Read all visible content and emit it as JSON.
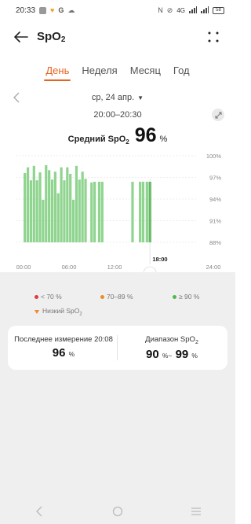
{
  "status_bar": {
    "time": "20:33",
    "network": "4G",
    "battery": "58"
  },
  "app_bar": {
    "title_main": "SpO",
    "title_sub": "2"
  },
  "tabs": [
    {
      "label": "День",
      "active": true
    },
    {
      "label": "Неделя",
      "active": false
    },
    {
      "label": "Месяц",
      "active": false
    },
    {
      "label": "Год",
      "active": false
    }
  ],
  "date": {
    "label": "ср, 24 апр.",
    "time_range": "20:00–20:30"
  },
  "average": {
    "label_main": "Средний SpO",
    "label_sub": "2",
    "value": "96",
    "unit": "%"
  },
  "chart_data": {
    "type": "bar",
    "y_ticks": [
      "100%",
      "97%",
      "94%",
      "91%",
      "88%"
    ],
    "x_ticks": [
      "00:00",
      "06:00",
      "12:00",
      "18:00",
      "24:00"
    ],
    "selected_time": "18:00",
    "ylim": [
      88,
      100
    ],
    "unit": "%",
    "bar_color": "#8fd48f",
    "highlight_color": "#43b343",
    "bars": [
      {
        "x": 1.2,
        "high": 97.6,
        "low": 88
      },
      {
        "x": 1.6,
        "high": 98.4,
        "low": 88
      },
      {
        "x": 2.0,
        "high": 96.6,
        "low": 88
      },
      {
        "x": 2.4,
        "high": 98.6,
        "low": 88
      },
      {
        "x": 2.8,
        "high": 96.6,
        "low": 88
      },
      {
        "x": 3.2,
        "high": 97.7,
        "low": 88
      },
      {
        "x": 3.6,
        "high": 93.9,
        "low": 88
      },
      {
        "x": 4.0,
        "high": 98.7,
        "low": 88
      },
      {
        "x": 4.4,
        "high": 98.0,
        "low": 88
      },
      {
        "x": 4.8,
        "high": 96.7,
        "low": 88
      },
      {
        "x": 5.2,
        "high": 97.8,
        "low": 88
      },
      {
        "x": 5.6,
        "high": 94.8,
        "low": 88
      },
      {
        "x": 6.0,
        "high": 98.4,
        "low": 88
      },
      {
        "x": 6.4,
        "high": 96.6,
        "low": 88
      },
      {
        "x": 6.8,
        "high": 98.4,
        "low": 88
      },
      {
        "x": 7.2,
        "high": 97.5,
        "low": 88
      },
      {
        "x": 7.6,
        "high": 93.9,
        "low": 88
      },
      {
        "x": 8.0,
        "high": 98.6,
        "low": 88
      },
      {
        "x": 8.4,
        "high": 96.7,
        "low": 88
      },
      {
        "x": 8.8,
        "high": 97.8,
        "low": 88
      },
      {
        "x": 9.2,
        "high": 96.8,
        "low": 88
      },
      {
        "x": 10.0,
        "high": 96.3,
        "low": 88
      },
      {
        "x": 10.4,
        "high": 96.4,
        "low": 88
      },
      {
        "x": 11.0,
        "high": 96.4,
        "low": 88
      },
      {
        "x": 11.4,
        "high": 96.4,
        "low": 88
      },
      {
        "x": 15.4,
        "high": 96.4,
        "low": 88
      },
      {
        "x": 16.4,
        "high": 96.4,
        "low": 88
      },
      {
        "x": 16.8,
        "high": 96.4,
        "low": 88
      },
      {
        "x": 17.3,
        "high": 96.4,
        "low": 88
      },
      {
        "x": 17.7,
        "high": 96.4,
        "low": 88,
        "selected": true
      }
    ]
  },
  "legend": {
    "red": "< 70 %",
    "orange": "70–89 %",
    "green": "≥ 90 %",
    "low_main": "Низкий SpO",
    "low_sub": "2",
    "red_color": "#e03a3a",
    "orange_color": "#f08a2c",
    "green_color": "#4cbb4c"
  },
  "card": {
    "last_label": "Последнее измерение 20:08",
    "last_value": "96",
    "last_unit": "%",
    "range_label_main": "Диапазон SpO",
    "range_label_sub": "2",
    "range_min": "90",
    "range_sep": "%~",
    "range_max": "99",
    "range_unit": "%"
  }
}
